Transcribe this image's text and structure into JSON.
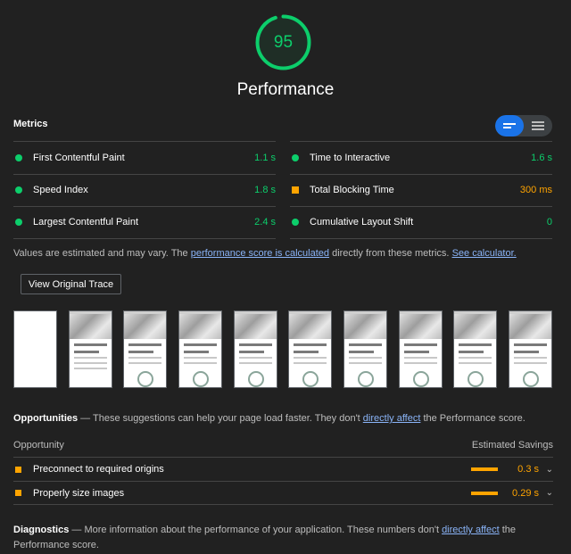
{
  "gauge": {
    "score": "95",
    "title": "Performance",
    "score_fraction": 0.95,
    "color": "#0cce6b"
  },
  "metrics": {
    "title": "Metrics",
    "view_toggle": [
      "list-view-icon",
      "table-view-icon"
    ],
    "left": [
      {
        "label": "First Contentful Paint",
        "value": "1.1 s",
        "status": "pass"
      },
      {
        "label": "Speed Index",
        "value": "1.8 s",
        "status": "pass"
      },
      {
        "label": "Largest Contentful Paint",
        "value": "2.4 s",
        "status": "pass"
      }
    ],
    "right": [
      {
        "label": "Time to Interactive",
        "value": "1.6 s",
        "status": "pass"
      },
      {
        "label": "Total Blocking Time",
        "value": "300 ms",
        "status": "average"
      },
      {
        "label": "Cumulative Layout Shift",
        "value": "0",
        "status": "pass"
      }
    ]
  },
  "estimate": {
    "prefix": "Values are estimated and may vary. The ",
    "link1": "performance score is calculated",
    "middle": " directly from these metrics. ",
    "link2": "See calculator."
  },
  "trace_button": "View Original Trace",
  "opportunities": {
    "title": "Opportunities",
    "dash": " — ",
    "desc_prefix": "These suggestions can help your page load faster. They don't ",
    "desc_link": "directly affect",
    "desc_suffix": " the Performance score.",
    "col_opportunity": "Opportunity",
    "col_savings": "Estimated Savings",
    "items": [
      {
        "label": "Preconnect to required origins",
        "saving": "0.3 s"
      },
      {
        "label": "Properly size images",
        "saving": "0.29 s"
      }
    ]
  },
  "diagnostics": {
    "title": "Diagnostics",
    "dash": " — ",
    "desc_prefix": "More information about the performance of your application. These numbers don't ",
    "desc_link": "directly affect",
    "desc_suffix": " the Performance score."
  },
  "colors": {
    "pass": "#0cce6b",
    "average": "#ffa400",
    "link": "#8ab4f8",
    "background": "#212121"
  }
}
